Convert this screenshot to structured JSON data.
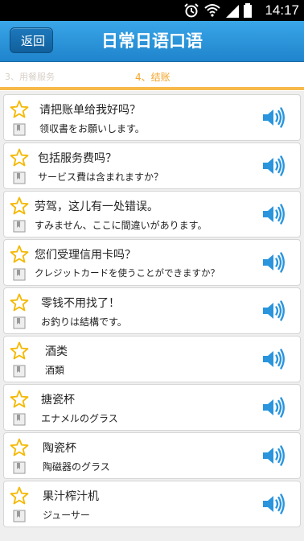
{
  "status": {
    "time": "14:17"
  },
  "header": {
    "back_label": "返回",
    "title": "日常日语口语"
  },
  "tabs": {
    "prev_label": "3、用餐服务",
    "current_label": "4、结账"
  },
  "phrases": [
    {
      "zh": "请把账单给我好吗？",
      "ja": "领収書をお願いします。"
    },
    {
      "zh": "包括服务费吗？",
      "ja": "サービス費は含まれますか？"
    },
    {
      "zh": "劳驾，这儿有一处错误。",
      "ja": "すみません、ここに間違いがあります。"
    },
    {
      "zh": "您们受理信用卡吗？",
      "ja": "クレジットカードを使うことができますか？"
    },
    {
      "zh": "零钱不用找了！",
      "ja": "お釣りは結構です。"
    },
    {
      "zh": "酒类",
      "ja": "酒類"
    },
    {
      "zh": "搪瓷杯",
      "ja": "エナメルのグラス"
    },
    {
      "zh": "陶瓷杯",
      "ja": "陶磁器のグラス"
    },
    {
      "zh": "果汁榨汁机",
      "ja": "ジューサー"
    }
  ],
  "colors": {
    "accent": "#2a95dd",
    "tab_active": "#f3a52b",
    "star": "#f5b800",
    "speaker": "#2a95dd"
  }
}
